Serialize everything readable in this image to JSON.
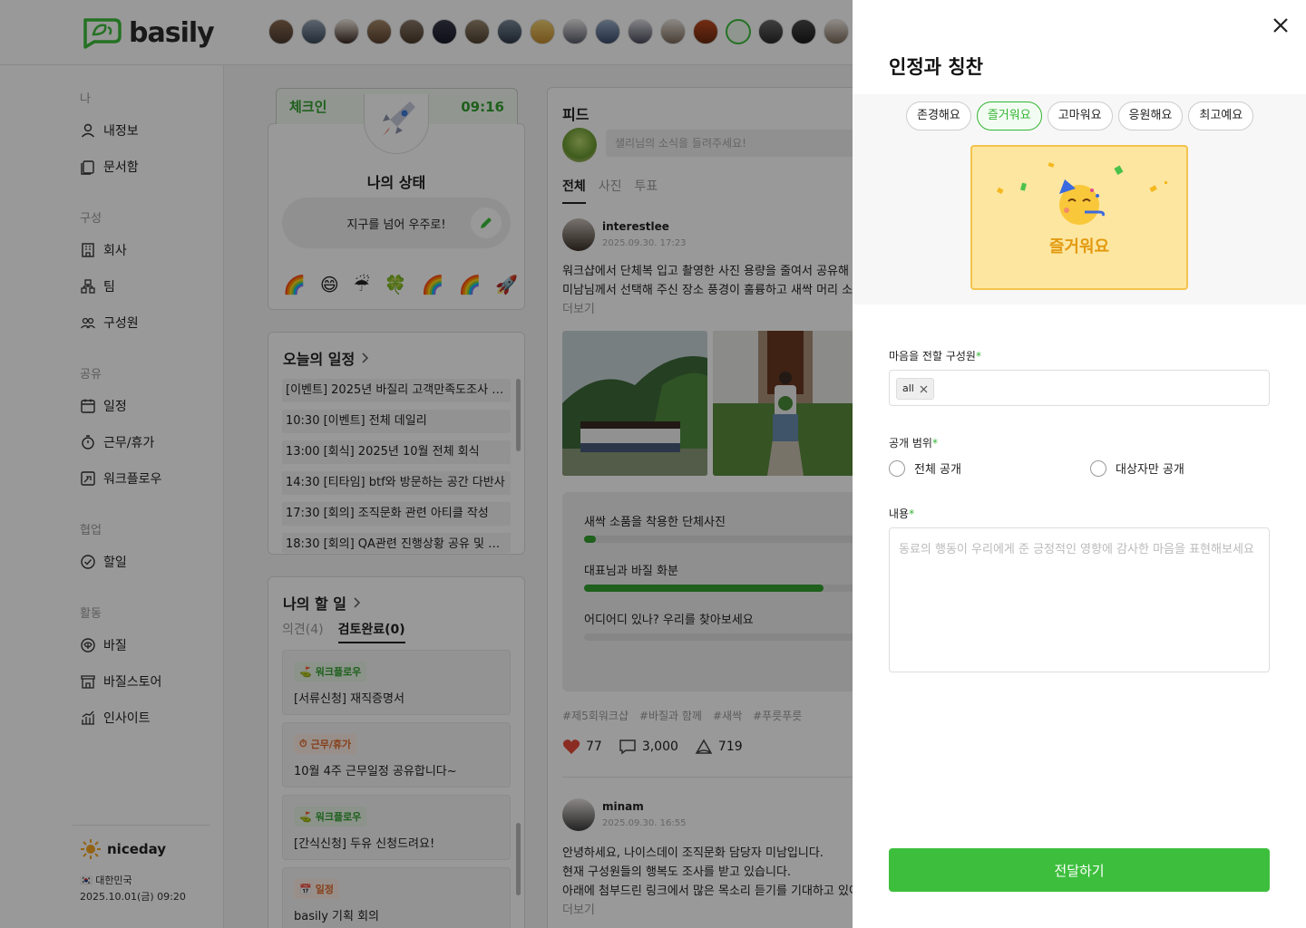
{
  "app": {
    "logo_text": "basily"
  },
  "sidebar": {
    "sections": [
      {
        "title": "나",
        "items": [
          {
            "label": "내정보",
            "icon": "user-icon"
          },
          {
            "label": "문서함",
            "icon": "document-icon"
          }
        ]
      },
      {
        "title": "구성",
        "items": [
          {
            "label": "회사",
            "icon": "building-icon"
          },
          {
            "label": "팀",
            "icon": "team-icon"
          },
          {
            "label": "구성원",
            "icon": "members-icon"
          }
        ]
      },
      {
        "title": "공유",
        "items": [
          {
            "label": "일정",
            "icon": "calendar-icon"
          },
          {
            "label": "근무/휴가",
            "icon": "timer-icon"
          },
          {
            "label": "워크플로우",
            "icon": "workflow-icon"
          }
        ]
      },
      {
        "title": "협업",
        "items": [
          {
            "label": "할일",
            "icon": "check-circle-icon"
          }
        ]
      },
      {
        "title": "활동",
        "items": [
          {
            "label": "바질",
            "icon": "leaf-icon"
          },
          {
            "label": "바질스토어",
            "icon": "store-icon"
          },
          {
            "label": "인사이트",
            "icon": "chart-icon"
          }
        ]
      }
    ],
    "brand": {
      "name": "niceday",
      "country": "🇰🇷 대한민국",
      "datetime": "2025.10.01(금) 09:20"
    }
  },
  "checkin": {
    "label": "체크인",
    "time": "09:16",
    "status_title": "나의 상태",
    "status_text": "지구를 넘어 우주로!",
    "emojis": [
      "🌈",
      "😄",
      "☔",
      "🍀",
      "🌈",
      "🌈",
      "🚀"
    ]
  },
  "schedule": {
    "title": "오늘의 일정",
    "items": [
      "[이벤트]  2025년 바질리 고객만족도조사 행...",
      "10:30  [이벤트] 전체 데일리",
      "13:00  [회식] 2025년 10월 전체 회식",
      "14:30  [티타임] btf와 방문하는 공간 다반사",
      "17:30  [회의] 조직문화 관련 아티클 작성",
      "18:30  [회의] QA관련 진행상황 공유 및 후속 ..."
    ]
  },
  "todo": {
    "title": "나의 할 일",
    "tabs": [
      "의견(4)",
      "검토완료(0)"
    ],
    "items": [
      {
        "tag": "워크플로우",
        "text": "[서류신청] 재직증명서"
      },
      {
        "tag": "근무/휴가",
        "text": "10월 4주 근무일정 공유합니다~"
      },
      {
        "tag": "워크플로우",
        "text": "[간식신청] 두유 신청드려요!"
      },
      {
        "tag": "일정",
        "text": "basily 기획 회의"
      }
    ]
  },
  "feed": {
    "title": "피드",
    "input_placeholder": "샐리님의 소식을 들려주세요!",
    "tabs": [
      "전체",
      "사진",
      "투표"
    ],
    "post1": {
      "author": "interestlee",
      "date": "2025.09.30. 17:23",
      "lines": [
        "워크샵에서 단체복 입고 촬영한 사진 용량을 줄여서 공유해 드려요",
        "미남님께서 선택해 주신 장소 풍경이 훌륭하고 새싹 머리 소품과도"
      ],
      "more": "더보기",
      "poll": [
        {
          "label": "새싹 소품을 착용한 단체사진",
          "fraction": 0.04
        },
        {
          "label": "대표님과 바질 화분",
          "fraction": 0.8
        },
        {
          "label": "어디어디 있나? 우리를 찾아보세요",
          "fraction": 0
        }
      ],
      "tags": [
        "#제5회워크샵",
        "#바질과 함께",
        "#새싹",
        "#푸릇푸릇"
      ],
      "likes": "77",
      "comments": "3,000",
      "views": "719"
    },
    "post2": {
      "author": "minam",
      "date": "2025.09.30. 16:55",
      "lines": [
        "안녕하세요, 나이스데이 조직문화 담당자 미남입니다.",
        "현재 구성원들의 행복도 조사를 받고 있습니다.",
        "아래에 첨부드린 링크에서 많은 목소리 듣기를 기대하고 있어요!"
      ],
      "more": "더보기"
    }
  },
  "drawer": {
    "title": "인정과 칭찬",
    "chips": [
      "존경해요",
      "즐거워요",
      "고마워요",
      "응원해요",
      "최고예요"
    ],
    "selected_chip": "즐거워요",
    "card_label": "즐거워요",
    "member_label": "마음을 전할 구성원",
    "member_tag": "all",
    "scope_label": "공개 범위",
    "scope_options": [
      "전체 공개",
      "대상자만 공개"
    ],
    "content_label": "내용",
    "content_placeholder": "동료의 행동이 우리에게 준 긍정적인 영향에 감사한 마음을 표현해보세요",
    "submit_label": "전달하기",
    "required_mark": "*"
  },
  "colors": {
    "brand_green": "#3dbf3d",
    "accent_yellow": "#fde6a0",
    "card_label": "#e39a10"
  }
}
